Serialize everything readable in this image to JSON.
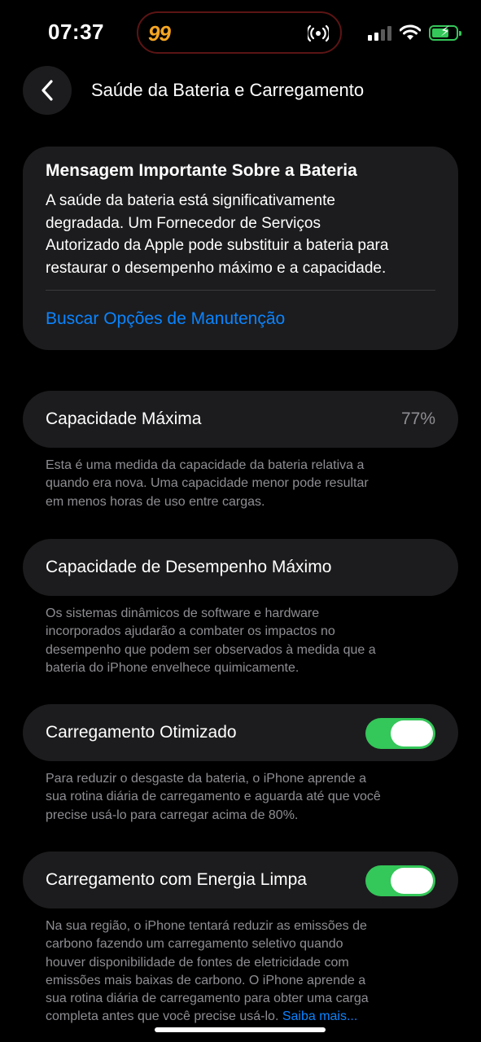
{
  "status_bar": {
    "time": "07:37",
    "island_app": "99",
    "battery_color": "#34c759"
  },
  "nav": {
    "back_icon": "chevron-left-icon",
    "title": "Saúde da Bateria e Carregamento"
  },
  "message": {
    "title": "Mensagem Importante Sobre a Bateria",
    "lines": [
      "A saúde da bateria está significativamente",
      "degradada. Um Fornecedor de Serviços",
      "Autorizado da Apple pode substituir a bateria para",
      "restaurar o desempenho máximo e a capacidade."
    ],
    "link": "Buscar Opções de Manutenção"
  },
  "max_capacity": {
    "label": "Capacidade Máxima",
    "value": "77%",
    "footnote": [
      "Esta é uma medida da capacidade da bateria relativa a",
      "quando era nova. Uma capacidade menor pode resultar",
      "em menos horas de uso entre cargas."
    ]
  },
  "peak_performance": {
    "label": "Capacidade de Desempenho Máximo",
    "footnote": [
      "Os sistemas dinâmicos de software e hardware",
      "incorporados ajudarão a combater os impactos no",
      "desempenho que podem ser observados à medida que a",
      "bateria do iPhone envelhece quimicamente."
    ]
  },
  "optimized_charging": {
    "label": "Carregamento Otimizado",
    "enabled": true,
    "footnote": [
      "Para reduzir o desgaste da bateria, o iPhone aprende a",
      "sua rotina diária de carregamento e aguarda até que você",
      "precise usá-lo para carregar acima de 80%."
    ]
  },
  "clean_energy": {
    "label": "Carregamento com Energia Limpa",
    "enabled": true,
    "footnote": [
      "Na sua região, o iPhone tentará reduzir as emissões de",
      "carbono fazendo um carregamento seletivo quando",
      "houver disponibilidade de fontes de eletricidade com",
      "emissões mais baixas de carbono. O iPhone aprende a",
      "sua rotina diária de carregamento para obter uma carga"
    ],
    "footnote_last": "completa antes que você precise usá-lo. ",
    "learn_more": "Saiba mais..."
  },
  "colors": {
    "accent": "#0a84ff",
    "toggle_on": "#34c759",
    "card_bg": "#1c1c1e",
    "secondary_text": "#8e8e93"
  }
}
